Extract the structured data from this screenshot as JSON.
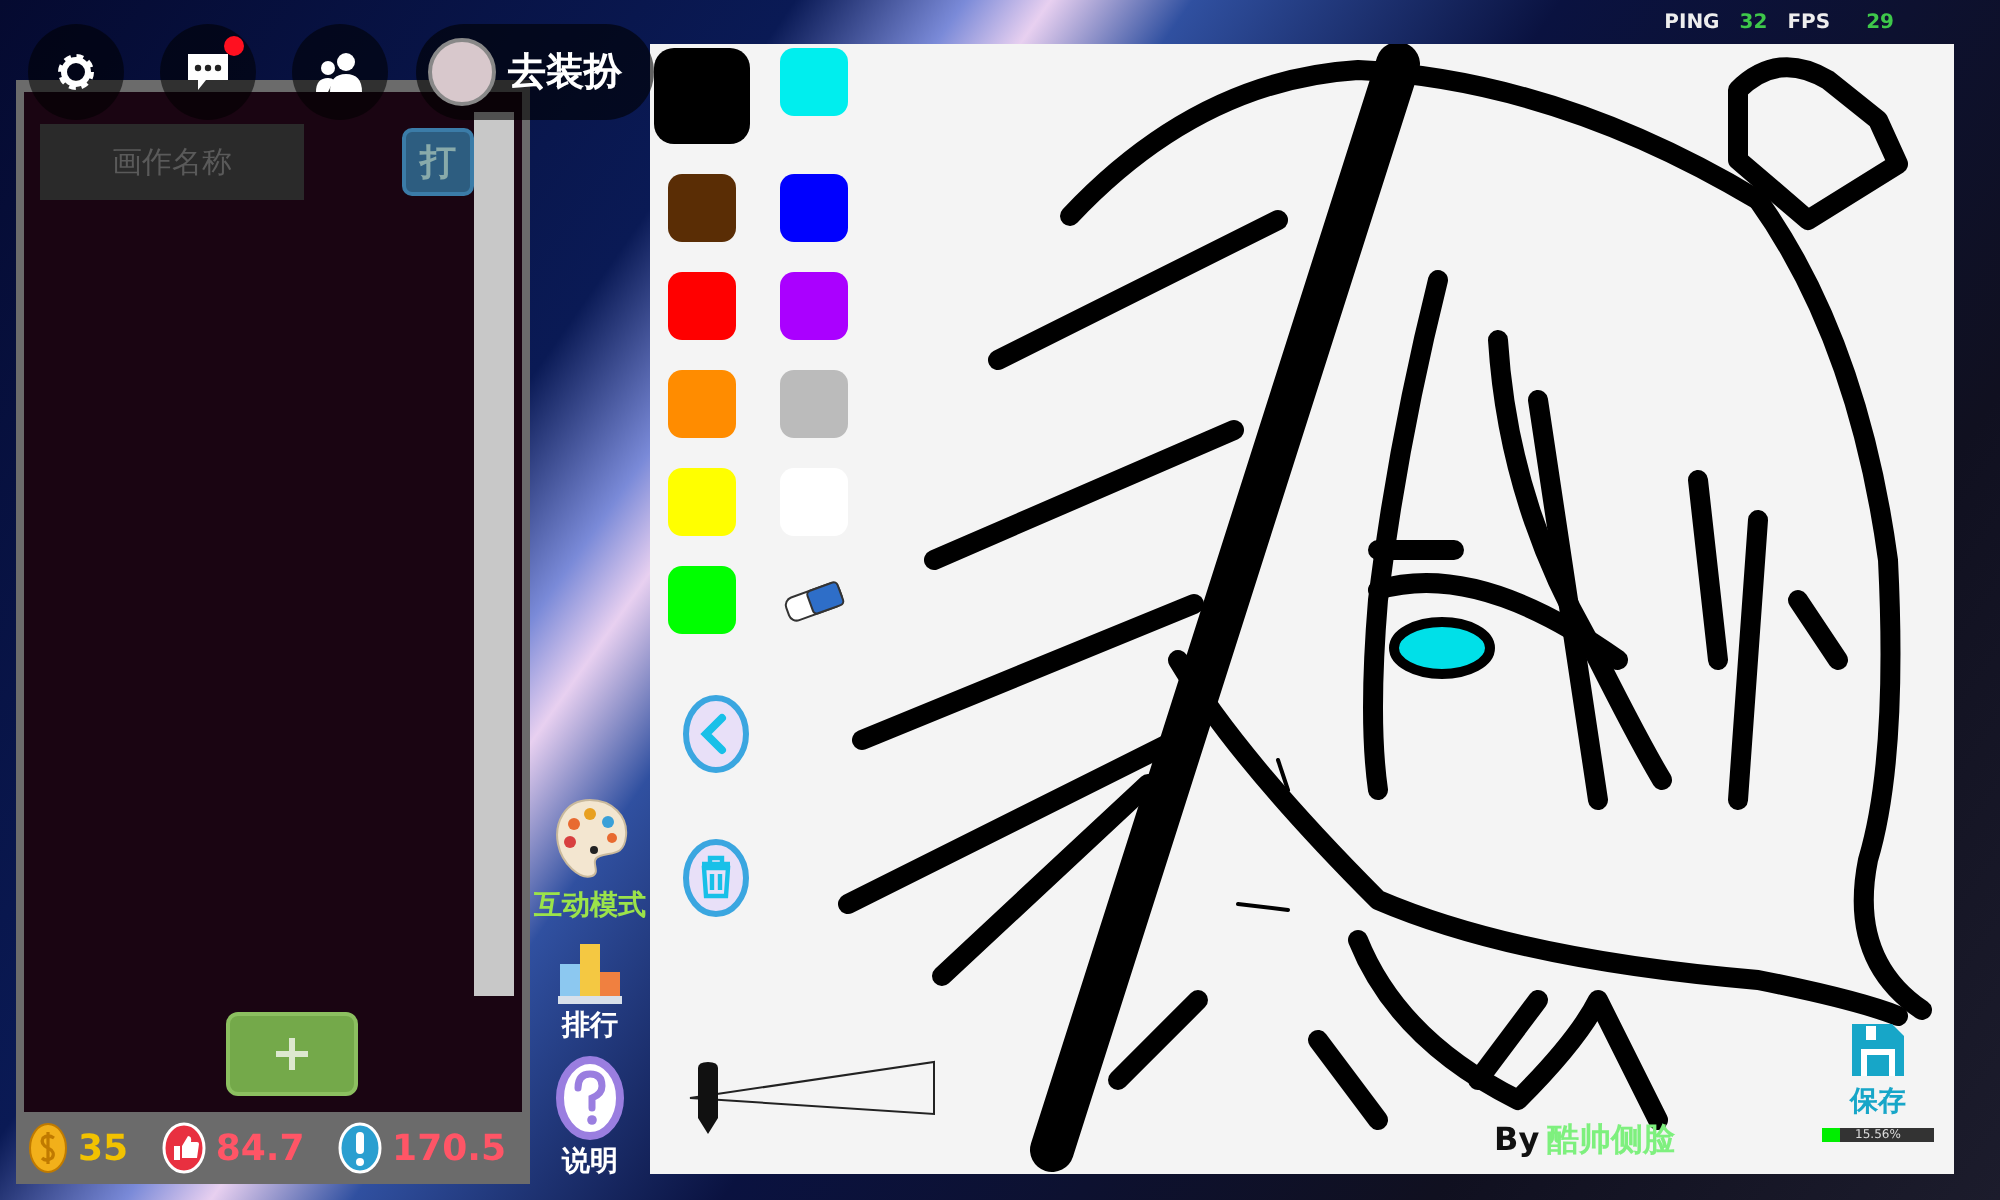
{
  "hud": {
    "chat_unread": true,
    "dress_up": {
      "label": "去装扮"
    }
  },
  "network": {
    "ping_label": "PING",
    "ping": "32",
    "fps_label": "FPS",
    "fps": "29"
  },
  "gallery_panel": {
    "title_field": {
      "placeholder": "画作名称"
    },
    "open_button": "打",
    "stats": [
      {
        "kind": "coin",
        "value": "35"
      },
      {
        "kind": "like",
        "value": "84.7"
      },
      {
        "kind": "alert",
        "value": "170.5"
      }
    ]
  },
  "side_menu": [
    {
      "kind": "palette",
      "label": "互动模式",
      "active": true
    },
    {
      "kind": "ranking",
      "label": "排行",
      "active": false
    },
    {
      "kind": "help",
      "label": "说明",
      "active": false
    }
  ],
  "canvas": {
    "swatches": [
      {
        "kind": "color",
        "color": "#000000",
        "selected": true
      },
      {
        "kind": "color",
        "color": "#00eeee",
        "selected": false
      },
      {
        "kind": "color",
        "color": "#5a2d05",
        "selected": false
      },
      {
        "kind": "color",
        "color": "#0000ff",
        "selected": false
      },
      {
        "kind": "color",
        "color": "#ff0000",
        "selected": false
      },
      {
        "kind": "color",
        "color": "#aa00ff",
        "selected": false
      },
      {
        "kind": "color",
        "color": "#ff8c00",
        "selected": false
      },
      {
        "kind": "color",
        "color": "#bbbbbb",
        "selected": false
      },
      {
        "kind": "color",
        "color": "#ffff00",
        "selected": false
      },
      {
        "kind": "color",
        "color": "#ffffff",
        "selected": false
      },
      {
        "kind": "color",
        "color": "#00ff00",
        "selected": false
      },
      {
        "kind": "eraser",
        "selected": false
      }
    ],
    "brush_size": {
      "level": 0.04
    },
    "credit": {
      "by": "By",
      "author": "酷帅侧脸"
    },
    "save": {
      "label": "保存",
      "progress": {
        "level": 0.1556,
        "reading": "15.56%"
      }
    }
  }
}
